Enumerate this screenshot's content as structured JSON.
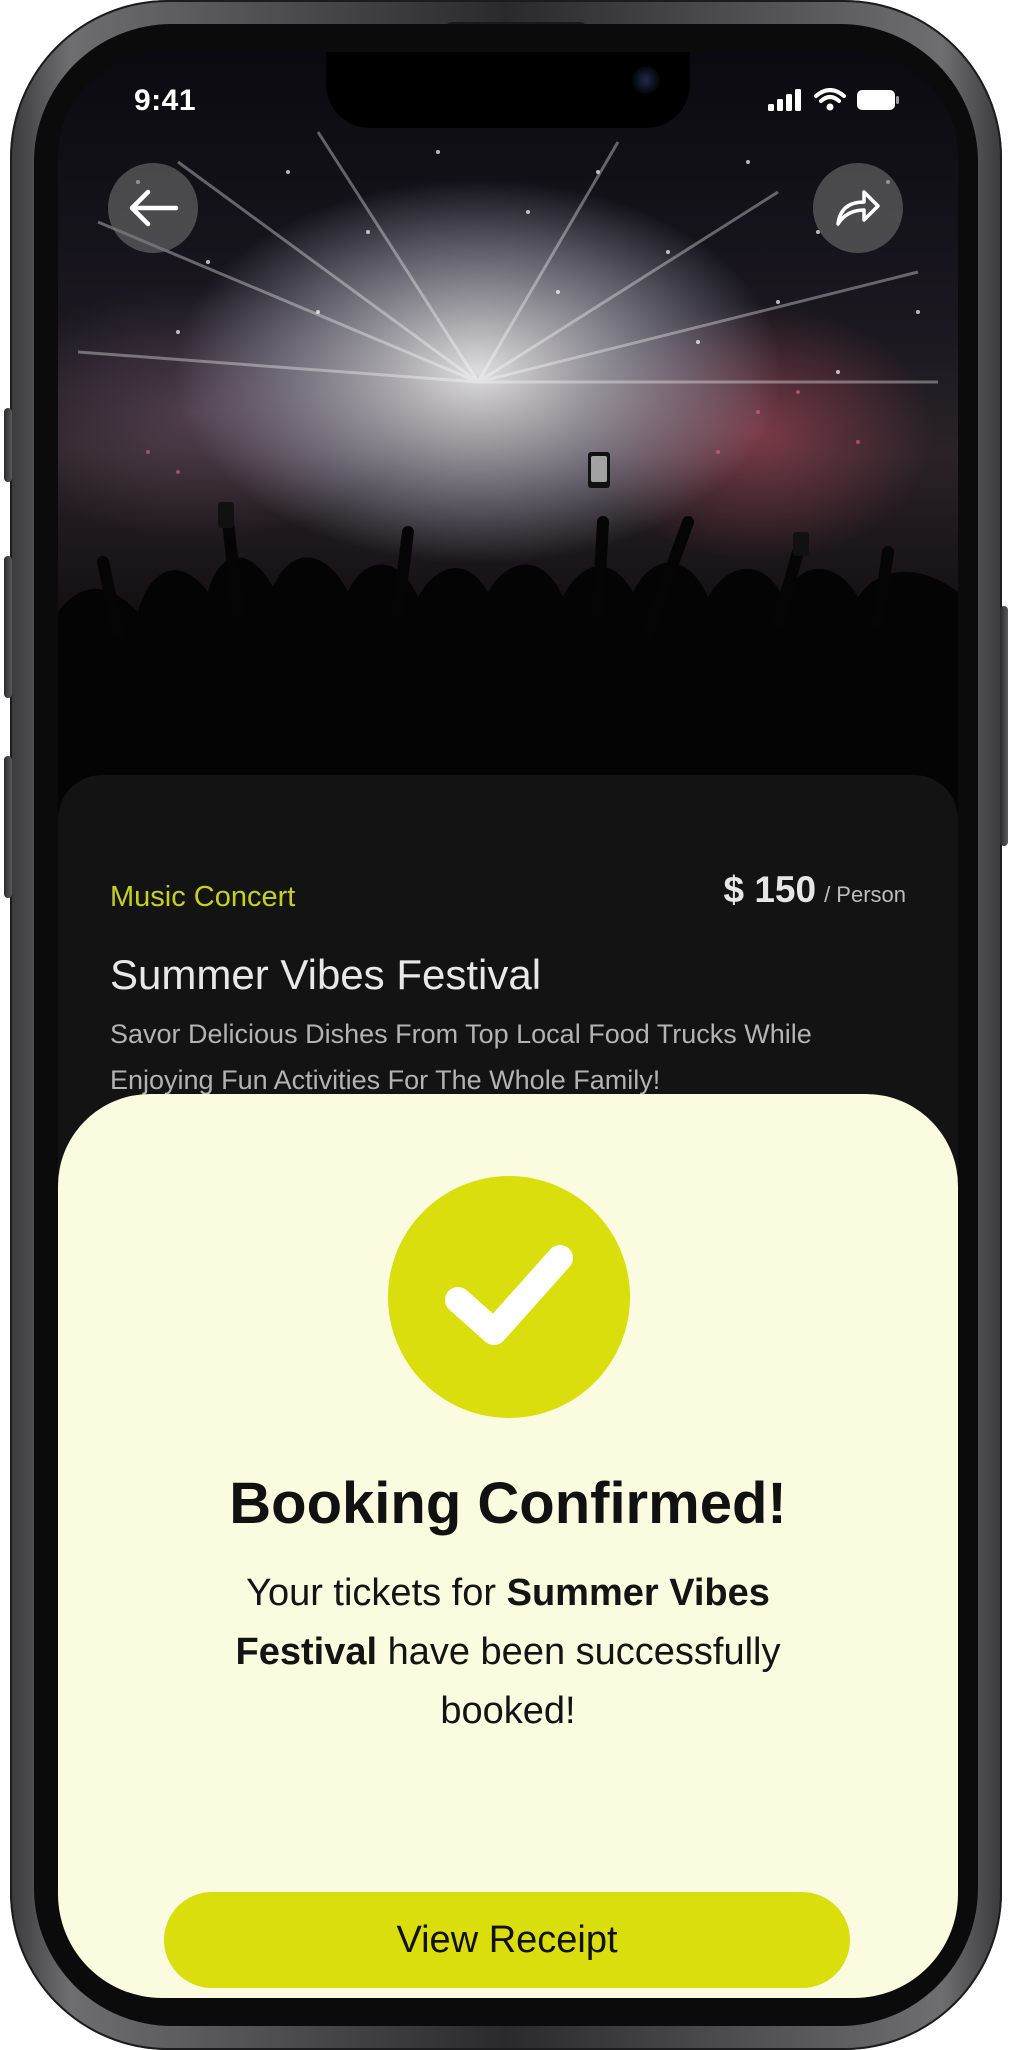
{
  "status_bar": {
    "time": "9:41",
    "icons": [
      "cellular-signal-icon",
      "wifi-icon",
      "battery-icon"
    ]
  },
  "hero": {
    "image": "concert-crowd-photo",
    "back_icon": "arrow-left-icon",
    "share_icon": "share-forward-icon"
  },
  "event": {
    "category": "Music Concert",
    "price": "$ 150",
    "price_unit": "/ Person",
    "title": "Summer Vibes Festival",
    "description": "Savor Delicious Dishes From Top Local Food Trucks While Enjoying Fun Activities For The Whole Family!"
  },
  "confirmation": {
    "icon": "checkmark-icon",
    "title": "Booking Confirmed!",
    "message_prefix": "Your tickets for ",
    "message_event": "Summer Vibes Festival",
    "message_suffix": " have been successfully booked!",
    "button_label": "View Receipt"
  },
  "colors": {
    "accent": "#dade0c",
    "category_text": "#c5d11f",
    "sheet_background": "#fbfbdf",
    "card_background": "#141314"
  }
}
